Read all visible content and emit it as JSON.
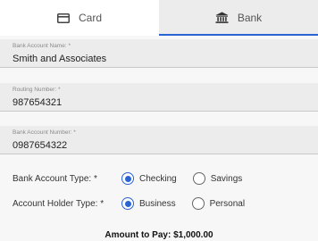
{
  "tabs": {
    "card_label": "Card",
    "bank_label": "Bank",
    "active": "Bank"
  },
  "fields": {
    "account_name": {
      "label": "Bank Account Name: *",
      "value": "Smith and Associates"
    },
    "routing_number": {
      "label": "Routing Number: *",
      "value": "987654321"
    },
    "account_number": {
      "label": "Bank Account Number: *",
      "value": "0987654322"
    }
  },
  "account_type": {
    "label": "Bank Account Type: *",
    "options": [
      "Checking",
      "Savings"
    ],
    "selected": "Checking"
  },
  "holder_type": {
    "label": "Account Holder Type: *",
    "options": [
      "Business",
      "Personal"
    ],
    "selected": "Business"
  },
  "amount_text": "Amount to Pay: $1,000.00",
  "colors": {
    "accent": "#2a63d4",
    "field_bg": "#ececec",
    "page_bg": "#f7f7f7"
  },
  "icons": {
    "card": "credit-card-icon",
    "bank": "bank-icon"
  }
}
